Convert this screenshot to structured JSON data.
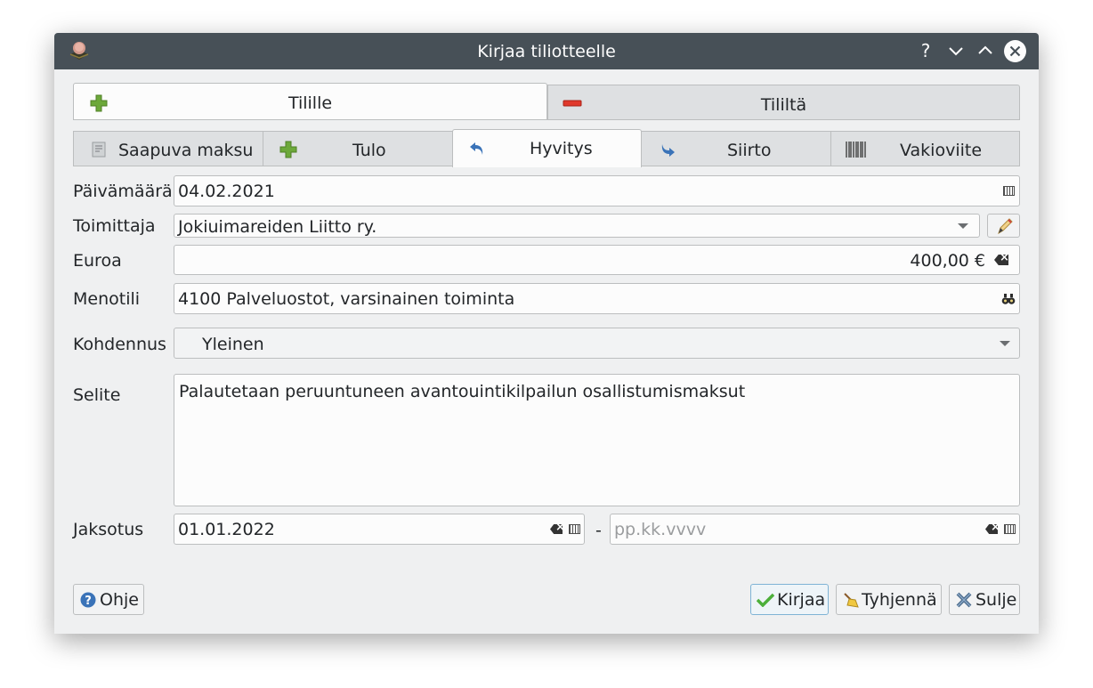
{
  "window": {
    "title": "Kirjaa tiliotteelle"
  },
  "tabs": [
    {
      "label": "Tilille",
      "active": true,
      "icon": "plus-icon"
    },
    {
      "label": "Tililtä",
      "active": false,
      "icon": "minus-icon"
    }
  ],
  "subtabs": [
    {
      "label": "Saapuva maksu",
      "icon": "receipt-icon"
    },
    {
      "label": "Tulo",
      "icon": "plus-icon"
    },
    {
      "label": "Hyvitys",
      "icon": "undo-arrow-icon",
      "active": true
    },
    {
      "label": "Siirto",
      "icon": "redo-arrow-icon"
    },
    {
      "label": "Vakioviite",
      "icon": "barcode-icon"
    }
  ],
  "form": {
    "date_label": "Päivämäärä",
    "date_value": "04.02.2021",
    "supplier_label": "Toimittaja",
    "supplier_value": "Jokiuimareiden Liitto ry.",
    "amount_label": "Euroa",
    "amount_value": "400,00 €",
    "account_label": "Menotili",
    "account_value": "4100 Palveluostot, varsinainen toiminta",
    "allocation_label": "Kohdennus",
    "allocation_value": "Yleinen",
    "description_label": "Selite",
    "description_value": "Palautetaan peruuntuneen avantouintikilpailun osallistumismaksut",
    "period_label": "Jaksotus",
    "period_start": "01.01.2022",
    "period_separator": "-",
    "period_end_placeholder": "pp.kk.vvvv"
  },
  "buttons": {
    "help": "Ohje",
    "submit": "Kirjaa",
    "clear": "Tyhjennä",
    "close": "Sulje"
  },
  "colors": {
    "titlebar": "#475057",
    "window_bg": "#eff0f1",
    "accent": "#3daee9"
  }
}
